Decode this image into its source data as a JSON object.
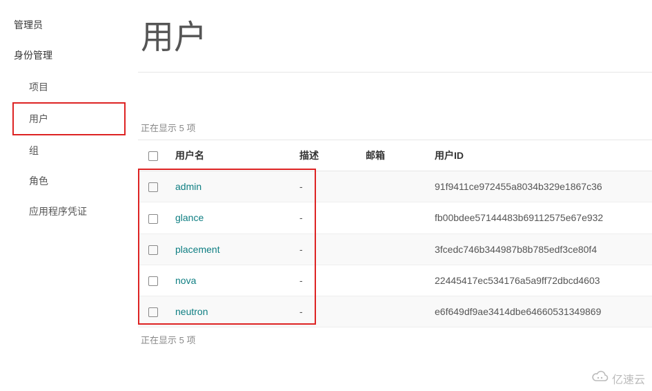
{
  "sidebar": {
    "top": "管理员",
    "section": "身份管理",
    "items": [
      {
        "label": "项目"
      },
      {
        "label": "用户"
      },
      {
        "label": "组"
      },
      {
        "label": "角色"
      },
      {
        "label": "应用程序凭证"
      }
    ]
  },
  "page": {
    "title": "用户",
    "count_label_top": "正在显示 5 项",
    "count_label_bottom": "正在显示 5 项"
  },
  "table": {
    "headers": {
      "name": "用户名",
      "desc": "描述",
      "mail": "邮箱",
      "userid": "用户ID"
    },
    "rows": [
      {
        "name": "admin",
        "desc": "-",
        "mail": "",
        "userid": "91f9411ce972455a8034b329e1867c36"
      },
      {
        "name": "glance",
        "desc": "-",
        "mail": "",
        "userid": "fb00bdee57144483b69112575e67e932"
      },
      {
        "name": "placement",
        "desc": "-",
        "mail": "",
        "userid": "3fcedc746b344987b8b785edf3ce80f4"
      },
      {
        "name": "nova",
        "desc": "-",
        "mail": "",
        "userid": "22445417ec534176a5a9ff72dbcd4603"
      },
      {
        "name": "neutron",
        "desc": "-",
        "mail": "",
        "userid": "e6f649df9ae3414dbe64660531349869"
      }
    ]
  },
  "watermark": "亿速云"
}
